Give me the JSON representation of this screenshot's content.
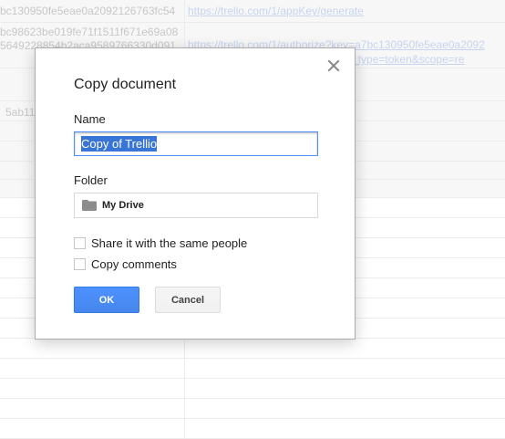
{
  "spreadsheet": {
    "cells": [
      "bc130950fe5eae0a2092126763fc54",
      "https://trello.com/1/appKey/generate",
      "bc98623be019fe71f1511f671e69a08",
      "5649228854b2aca9589766330d091",
      "https://trello.com/1/authorize?key=a7bc130950fe5eae0a2092",
      "onse_type=token&scope=re",
      "5ab11"
    ]
  },
  "dialog": {
    "title": "Copy document",
    "name_label": "Name",
    "name_value": "Copy of Trellio",
    "folder_label": "Folder",
    "folder_value": "My Drive",
    "share_label": "Share it with the same people",
    "share_checked": false,
    "copy_comments_label": "Copy comments",
    "copy_comments_checked": false,
    "ok_label": "OK",
    "cancel_label": "Cancel",
    "accent_color": "#4d90fe"
  }
}
